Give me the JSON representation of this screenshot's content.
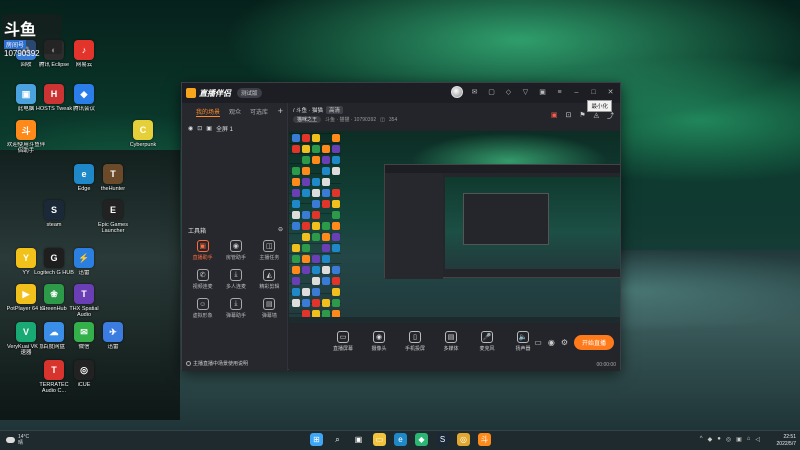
{
  "desktop": {
    "room_badge": {
      "big": "斗鱼",
      "room_label": "房间号",
      "room_number": "10790392"
    },
    "icons": [
      {
        "label": "回收",
        "color": "#3a7bd5",
        "glyph": "♻"
      },
      {
        "label": "腾讯 Eclipse",
        "color": "#2d2d2d",
        "glyph": "◐"
      },
      {
        "label": "网易云",
        "color": "#e2342b",
        "glyph": "♪"
      },
      {
        "label": "此电脑",
        "color": "#4aa3df",
        "glyph": "▣"
      },
      {
        "label": "HOSTS Tweak",
        "color": "#cc3333",
        "glyph": "H"
      },
      {
        "label": "腾讯会议",
        "color": "#2b7de9",
        "glyph": "◆"
      },
      {
        "label": "欢迎使用斗鱼伴侣助手",
        "color": "#ff8a1a",
        "glyph": "斗"
      },
      {
        "label": "Cyberpunk",
        "color": "#e6d03a",
        "glyph": "C"
      },
      {
        "label": "Edge",
        "color": "#1e88c9",
        "glyph": "e"
      },
      {
        "label": "theHunter",
        "color": "#6b4a2a",
        "glyph": "T"
      },
      {
        "label": "steam",
        "color": "#1b2838",
        "glyph": "S"
      },
      {
        "label": "Epic Games Launcher",
        "color": "#222222",
        "glyph": "E"
      },
      {
        "label": "YY",
        "color": "#f3c21a",
        "glyph": "Y"
      },
      {
        "label": "Logitech G HUB",
        "color": "#1e1e1e",
        "glyph": "G"
      },
      {
        "label": "迅雷",
        "color": "#2a7fe0",
        "glyph": "⚡"
      },
      {
        "label": "PotPlayer 64 bit",
        "color": "#f2c01d",
        "glyph": "▶"
      },
      {
        "label": "GreenHub",
        "color": "#2d9a4a",
        "glyph": "❀"
      },
      {
        "label": "THX Spatial Audio",
        "color": "#6a3fb5",
        "glyph": "T"
      },
      {
        "label": "VeryKuai VK 加速器",
        "color": "#19a974",
        "glyph": "V"
      },
      {
        "label": "百度网盘",
        "color": "#3b8ee8",
        "glyph": "☁"
      },
      {
        "label": "微信",
        "color": "#33b04a",
        "glyph": "✉"
      },
      {
        "label": "迅雷",
        "color": "#3c7be0",
        "glyph": "✈"
      },
      {
        "label": "TERRATEC Audio C...",
        "color": "#d8342d",
        "glyph": "T"
      },
      {
        "label": "iCUE",
        "color": "#222222",
        "glyph": "◎"
      }
    ]
  },
  "app": {
    "name": "直播伴侣",
    "version_pill": "测试版",
    "tooltip": "最小化",
    "sidebar": {
      "tabs": [
        "我的场景",
        "观众",
        "可选库"
      ],
      "scene_name": "全屏 1",
      "tools_title": "工具箱",
      "tools": [
        {
          "label": "直播助手",
          "glyph": "▣",
          "hot": true
        },
        {
          "label": "房管助手",
          "glyph": "◉",
          "hot": false
        },
        {
          "label": "主播任务",
          "glyph": "◫",
          "hot": false
        },
        {
          "label": "视频连麦",
          "glyph": "✆",
          "hot": false
        },
        {
          "label": "多人连麦",
          "glyph": "⤓",
          "hot": false
        },
        {
          "label": "精彩剪辑",
          "glyph": "◭",
          "hot": false
        },
        {
          "label": "虚拟形象",
          "glyph": "☺",
          "hot": false
        },
        {
          "label": "弹幕助手",
          "glyph": "⤓",
          "hot": false
        },
        {
          "label": "弹幕墙",
          "glyph": "▤",
          "hot": false
        }
      ],
      "hint": "主播直播中场景使用说明"
    },
    "header": {
      "crumb_label": "/ 斗鱼 · 猫猫",
      "crumb_tag": "高清",
      "room_chip": "猫咪之王",
      "room_text": "斗鱼 · 猫猫 · 10790392",
      "count": "354"
    },
    "controls": [
      {
        "label": "直播屏幕",
        "glyph": "▭"
      },
      {
        "label": "摄像头",
        "glyph": "◉"
      },
      {
        "label": "手机投屏",
        "glyph": "▯"
      },
      {
        "label": "多媒体",
        "glyph": "▤"
      },
      {
        "label": "麦克风",
        "glyph": "🎤"
      },
      {
        "label": "扬声器",
        "glyph": "🔈"
      }
    ],
    "start_button": "开始直播",
    "timer": "00:00:00"
  },
  "taskbar": {
    "temp": "14°C",
    "weather": "晴",
    "time": "22:51",
    "date": "2022/5/7",
    "apps": [
      {
        "name": "windows-start",
        "color": "#3da6f5",
        "glyph": "⊞"
      },
      {
        "name": "search",
        "color": "#1f2a2f",
        "glyph": "⌕"
      },
      {
        "name": "task-view",
        "color": "#1f2a2f",
        "glyph": "▣"
      },
      {
        "name": "file-explorer",
        "color": "#f2c43d",
        "glyph": "▭"
      },
      {
        "name": "edge",
        "color": "#1e88c9",
        "glyph": "e"
      },
      {
        "name": "shield-app",
        "color": "#2bb673",
        "glyph": "◆"
      },
      {
        "name": "steam",
        "color": "#1b2838",
        "glyph": "S"
      },
      {
        "name": "chrome",
        "color": "#e0a82e",
        "glyph": "◎"
      },
      {
        "name": "douyu-companion",
        "color": "#ff8a1a",
        "glyph": "斗"
      }
    ]
  }
}
